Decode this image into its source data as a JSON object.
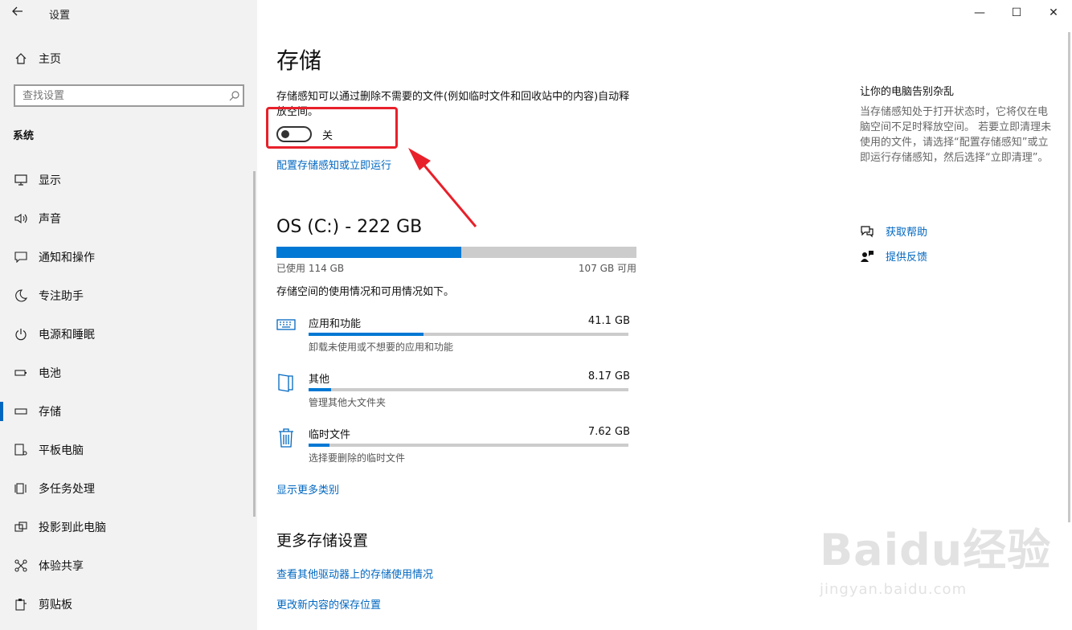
{
  "window": {
    "app_title": "设置",
    "minimize": "—",
    "maximize": "☐",
    "close": "✕"
  },
  "sidebar": {
    "home_label": "主页",
    "search_placeholder": "查找设置",
    "section_title": "系统",
    "items": [
      {
        "label": "显示",
        "icon": "monitor-icon"
      },
      {
        "label": "声音",
        "icon": "speaker-icon"
      },
      {
        "label": "通知和操作",
        "icon": "notification-icon"
      },
      {
        "label": "专注助手",
        "icon": "moon-icon"
      },
      {
        "label": "电源和睡眠",
        "icon": "power-icon"
      },
      {
        "label": "电池",
        "icon": "battery-icon"
      },
      {
        "label": "存储",
        "icon": "storage-icon",
        "active": true
      },
      {
        "label": "平板电脑",
        "icon": "tablet-icon"
      },
      {
        "label": "多任务处理",
        "icon": "multitask-icon"
      },
      {
        "label": "投影到此电脑",
        "icon": "project-icon"
      },
      {
        "label": "体验共享",
        "icon": "share-icon"
      },
      {
        "label": "剪贴板",
        "icon": "clipboard-icon"
      }
    ]
  },
  "main": {
    "title": "存储",
    "storage_sense_desc": "存储感知可以通过删除不需要的文件(例如临时文件和回收站中的内容)自动释放空间。",
    "toggle_state": "关",
    "toggle_on": false,
    "config_link": "配置存储感知或立即运行",
    "drive": {
      "title": "OS (C:) - 222 GB",
      "used": "已使用 114 GB",
      "available": "107 GB 可用",
      "used_fraction": 0.5135
    },
    "usage_desc": "存储空间的使用情况和可用情况如下。",
    "categories": [
      {
        "name": "应用和功能",
        "size": "41.1 GB",
        "sub": "卸载未使用或不想要的应用和功能",
        "icon": "keyboard-icon",
        "fraction": 0.36
      },
      {
        "name": "其他",
        "size": "8.17 GB",
        "sub": "管理其他大文件夹",
        "icon": "folder-icon",
        "fraction": 0.07
      },
      {
        "name": "临时文件",
        "size": "7.62 GB",
        "sub": "选择要删除的临时文件",
        "icon": "trash-icon",
        "fraction": 0.065
      }
    ],
    "show_more": "显示更多类别",
    "more_title": "更多存储设置",
    "other_drives_link": "查看其他驱动器上的存储使用情况",
    "save_location_link": "更改新内容的保存位置"
  },
  "right_panel": {
    "title": "让你的电脑告别杂乱",
    "text": "当存储感知处于打开状态时，它将仅在电脑空间不足时释放空间。 若要立即清理未使用的文件，请选择“配置存储感知”或立即运行存储感知，然后选择“立即清理”。",
    "help_link": "获取帮助",
    "feedback_link": "提供反馈"
  },
  "watermark": {
    "logo": "Baidu经验",
    "url": "jingyan.baidu.com"
  },
  "colors": {
    "accent": "#0067c0",
    "bar_fill": "#0078d4",
    "annotation": "#e8202a"
  }
}
